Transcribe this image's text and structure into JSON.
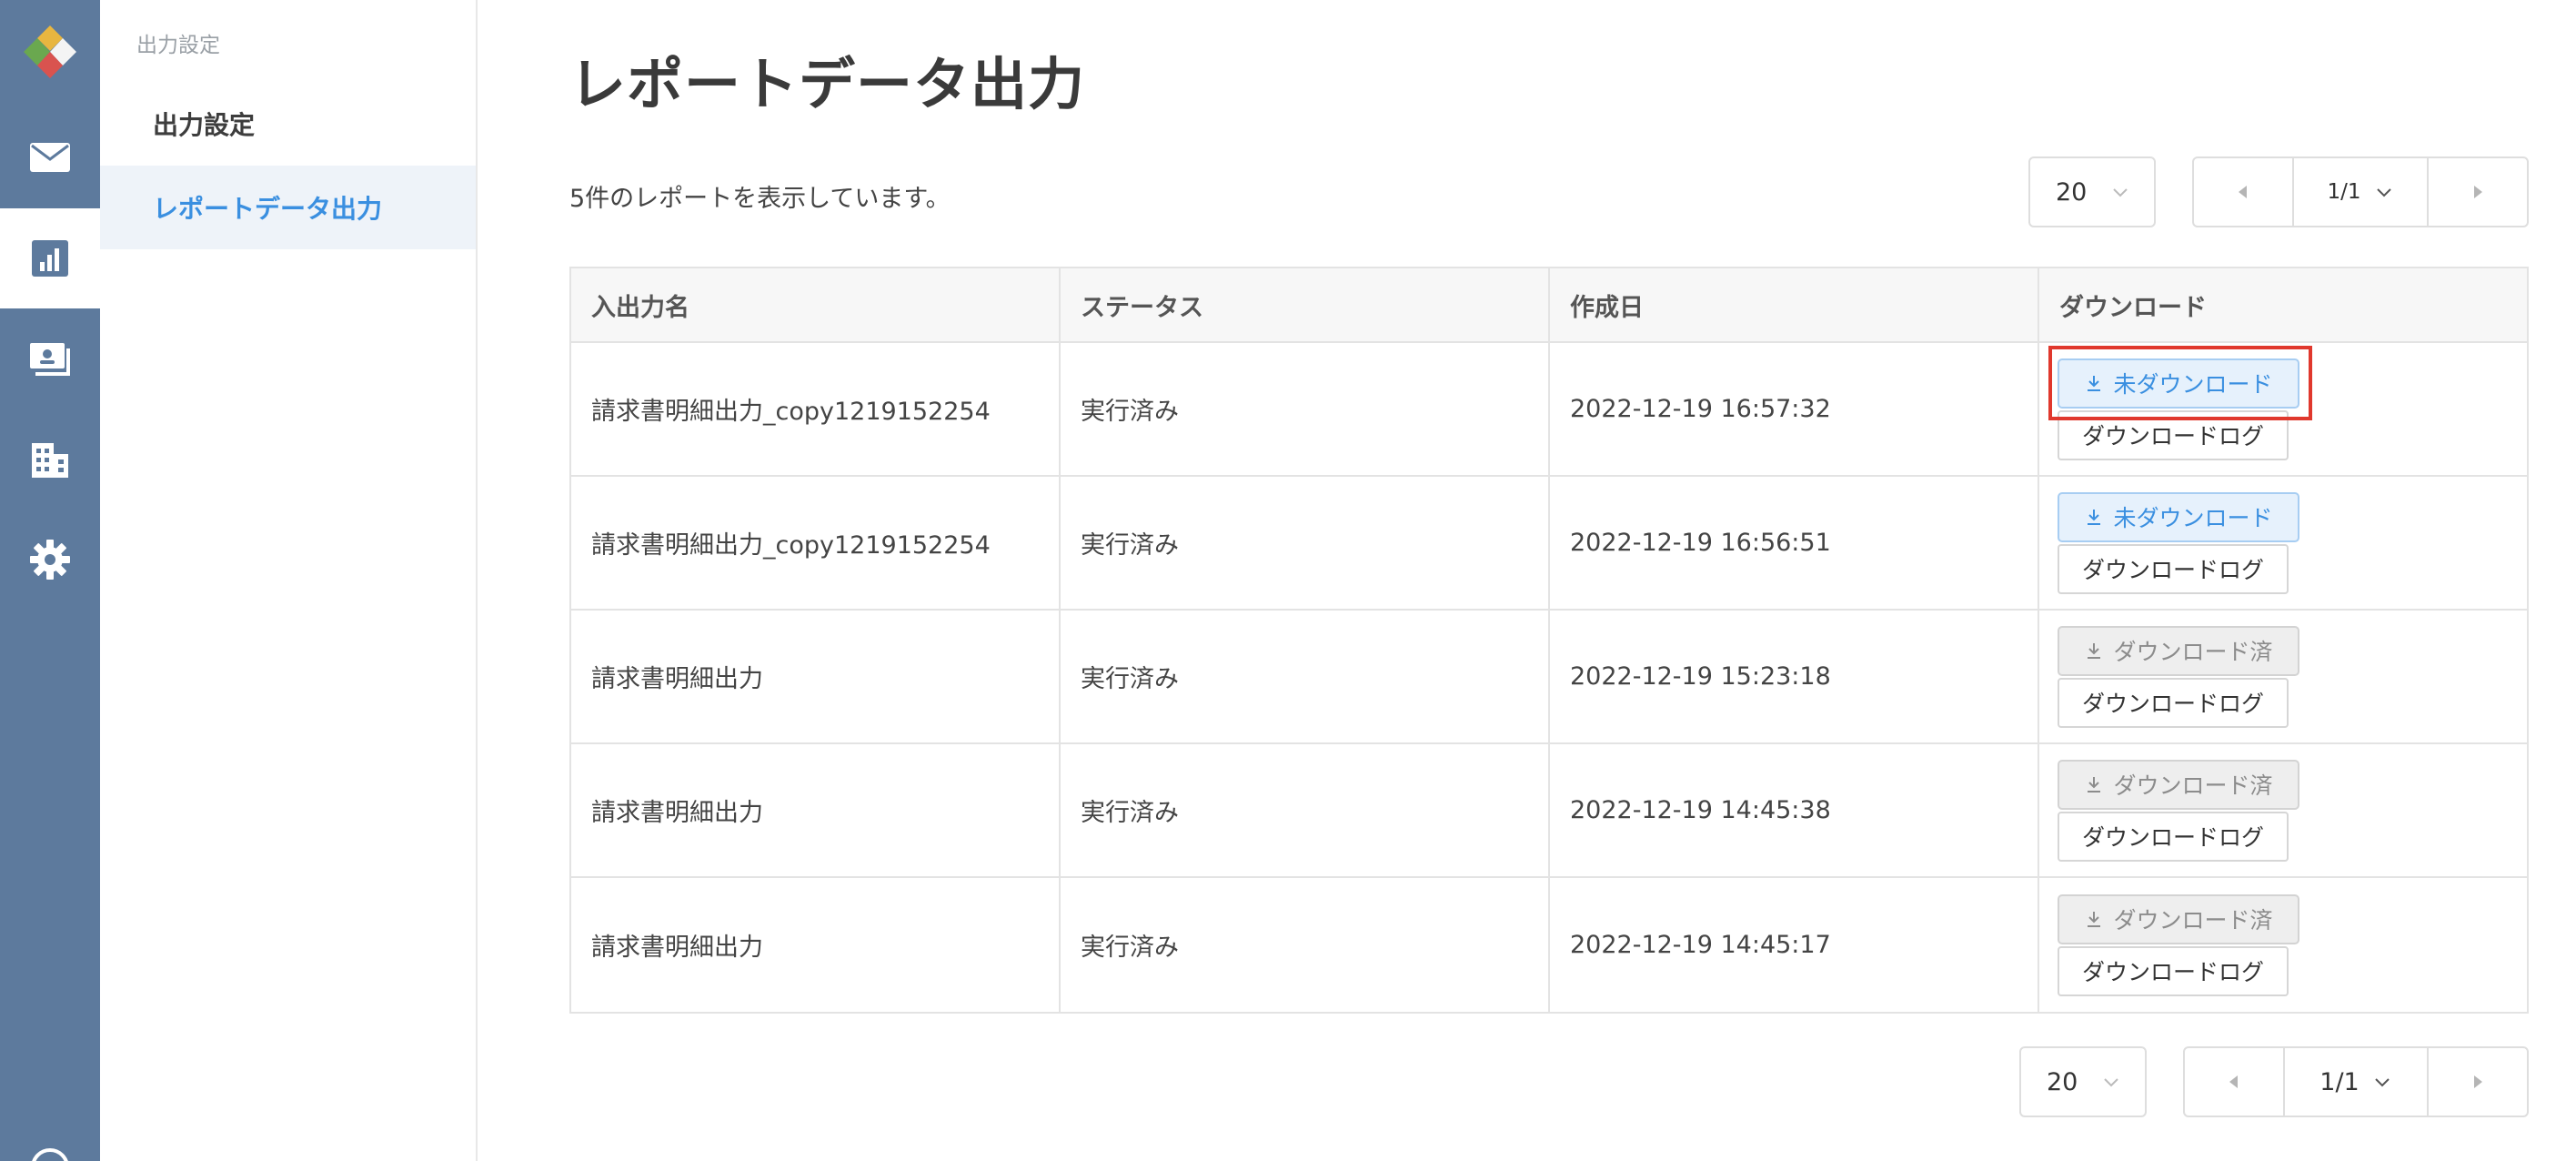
{
  "rail": {
    "items": [
      {
        "icon": "mail-icon"
      },
      {
        "icon": "report-chart-icon",
        "active": true
      },
      {
        "icon": "invoice-card-icon"
      },
      {
        "icon": "building-icon"
      },
      {
        "icon": "gear-icon"
      }
    ]
  },
  "subnav": {
    "header": "出力設定",
    "items": [
      {
        "label": "出力設定"
      },
      {
        "label": "レポートデータ出力",
        "active": true
      }
    ]
  },
  "page": {
    "title": "レポートデータ出力",
    "count_text": "5件のレポートを表示しています。"
  },
  "pager_top": {
    "page_size": "20",
    "page": "1/1"
  },
  "pager_bottom": {
    "page_size": "20",
    "page": "1/1"
  },
  "table": {
    "headers": [
      "入出力名",
      "ステータス",
      "作成日",
      "ダウンロード"
    ],
    "rows": [
      {
        "name": "請求書明細出力_copy1219152254",
        "status": "実行済み",
        "date": "2022-12-19 16:57:32",
        "download": "未ダウンロード",
        "log": "ダウンロードログ"
      },
      {
        "name": "請求書明細出力_copy1219152254",
        "status": "実行済み",
        "date": "2022-12-19 16:56:51",
        "download": "未ダウンロード",
        "log": "ダウンロードログ"
      },
      {
        "name": "請求書明細出力",
        "status": "実行済み",
        "date": "2022-12-19 15:23:18",
        "download": "ダウンロード済",
        "log": "ダウンロードログ"
      },
      {
        "name": "請求書明細出力",
        "status": "実行済み",
        "date": "2022-12-19 14:45:38",
        "download": "ダウンロード済",
        "log": "ダウンロードログ"
      },
      {
        "name": "請求書明細出力",
        "status": "実行済み",
        "date": "2022-12-19 14:45:17",
        "download": "ダウンロード済",
        "log": "ダウンロードログ"
      }
    ]
  },
  "colors": {
    "rail_bg": "#5d7a9d",
    "accent": "#3a8fe0",
    "highlight": "#e0382d"
  }
}
